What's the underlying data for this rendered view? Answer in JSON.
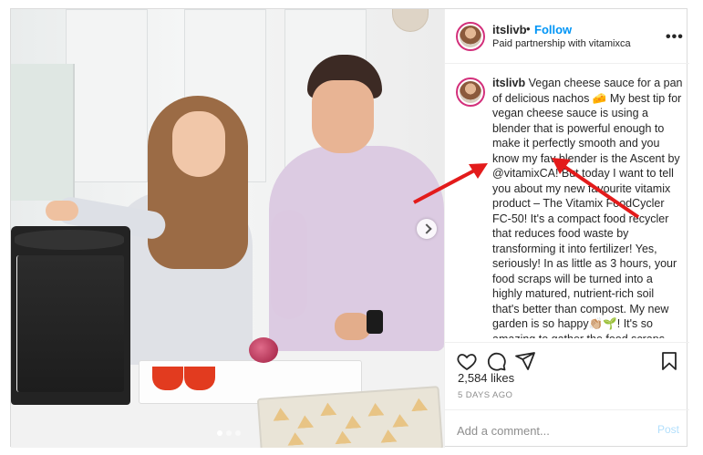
{
  "post": {
    "username": "itslivb",
    "separator": "•",
    "follow_label": "Follow",
    "subtitle": "Paid partnership with vitamixca",
    "more_label": "•••",
    "caption_username": "itslivb",
    "caption_text": "Vegan cheese sauce for a pan of delicious nachos 🧀 My best tip for vegan cheese sauce is using a blender that is powerful enough to make it perfectly smooth and you know my fav blender is the Ascent by @vitamixCA! But today I want to tell you about my new favourite vitamix product – The Vitamix FoodCycler FC-50! It's a compact food recycler that reduces food waste by transforming it into fertilizer! Yes, seriously! In as little as 3 hours, your food scraps will be turned into a highly matured, nutrient-rich soil that's better than compost. My new garden is so happy👏🏼🌱! It's so amazing to gather the food scraps from each day into the container, and then run it while we sleep. It's super",
    "likes": "2,584 likes",
    "date": "5 DAYS AGO",
    "comment_placeholder": "Add a comment...",
    "post_label": "Post"
  },
  "carousel": {
    "slide_count": 3,
    "active_index": 0
  },
  "icons": {
    "like": "heart-icon",
    "comment": "comment-icon",
    "share": "share-icon",
    "save": "bookmark-icon",
    "next": "chevron-right-icon"
  },
  "colors": {
    "follow": "#0095f6",
    "avatar_ring": "#d3307b",
    "post_disabled": "#b2dffc",
    "annotation_arrow": "#e31b1b"
  }
}
